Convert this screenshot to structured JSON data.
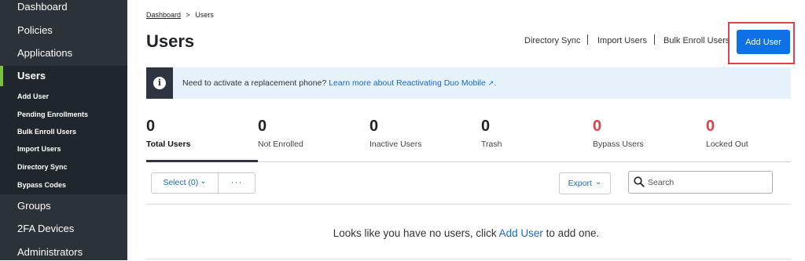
{
  "sidebar": {
    "items": [
      {
        "label": "Dashboard"
      },
      {
        "label": "Policies"
      },
      {
        "label": "Applications"
      },
      {
        "label": "Users"
      },
      {
        "label": "Groups"
      },
      {
        "label": "2FA Devices"
      },
      {
        "label": "Administrators"
      }
    ],
    "users_subitems": [
      {
        "label": "Add User"
      },
      {
        "label": "Pending Enrollments"
      },
      {
        "label": "Bulk Enroll Users"
      },
      {
        "label": "Import Users"
      },
      {
        "label": "Directory Sync"
      },
      {
        "label": "Bypass Codes"
      }
    ]
  },
  "breadcrumb": {
    "root": "Dashboard",
    "separator": ">",
    "current": "Users"
  },
  "page": {
    "title": "Users"
  },
  "header_links": {
    "directory_sync": "Directory Sync",
    "import_users": "Import Users",
    "bulk_enroll": "Bulk Enroll Users"
  },
  "add_user_button": "Add User",
  "banner": {
    "icon": "info-icon",
    "text": "Need to activate a replacement phone?",
    "link": "Learn more about Reactivating Duo Mobile",
    "external_icon": "external-link-icon",
    "external_glyph": "↗"
  },
  "stats": [
    {
      "value": "0",
      "label": "Total Users"
    },
    {
      "value": "0",
      "label": "Not Enrolled"
    },
    {
      "value": "0",
      "label": "Inactive Users"
    },
    {
      "value": "0",
      "label": "Trash"
    },
    {
      "value": "0",
      "label": "Bypass Users"
    },
    {
      "value": "0",
      "label": "Locked Out"
    }
  ],
  "toolbar": {
    "select_label": "Select (0)",
    "select_chevron": "⌄",
    "more_label": "···",
    "export_label": "Export",
    "export_chevron": "⌄",
    "search_placeholder": "Search"
  },
  "empty_state": {
    "prefix": "Looks like you have no users, click",
    "link": "Add User",
    "suffix": "to add one."
  },
  "colors": {
    "accent": "#1070e6",
    "highlight_border": "#e2414b",
    "sidebar_bg": "#2b3238",
    "active_indicator": "#7ac142",
    "alert_red": "#e2414b"
  }
}
